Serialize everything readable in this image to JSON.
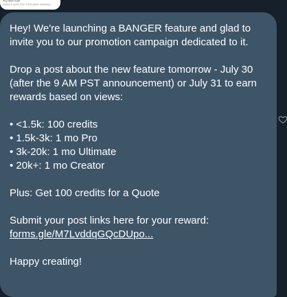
{
  "quoted_card": {
    "line1": "Your Main Post*",
    "line2": "replies & quote from a discussion elsewhere"
  },
  "message": {
    "paragraph1": "Hey! We're launching a BANGER feature and glad to invite you to our promotion campaign dedicated to it.",
    "paragraph2": "Drop a post about the new feature tomorrow - July 30 (after the 9 AM PST announcement) or July 31 to earn rewards based on views:",
    "rewards": [
      "• <1.5k: 100 credits",
      "• 1.5k-3k: 1 mo Pro",
      "• 3k-20k: 1 mo Ultimate",
      "• 20k+: 1 mo Creator"
    ],
    "paragraph3": "Plus: Get 100 credits for a Quote",
    "submit_text": "Submit your post links here for your reward:",
    "link_text": "forms.gle/M7LvddqGQcDUpo...",
    "closing": "Happy creating!"
  },
  "icons": {
    "heart": "heart-icon"
  },
  "colors": {
    "background": "#15202b",
    "bubble": "#3e5568",
    "text": "#ffffff"
  }
}
